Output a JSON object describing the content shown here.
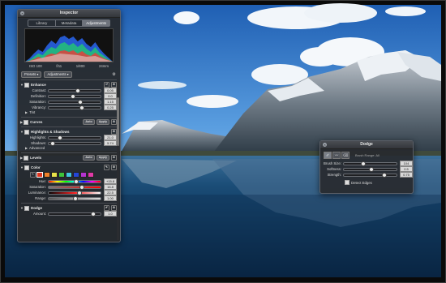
{
  "inspector": {
    "title": "Inspector",
    "tabs": [
      {
        "label": "Library",
        "active": false
      },
      {
        "label": "Metadata",
        "active": false
      },
      {
        "label": "Adjustments",
        "active": true
      }
    ],
    "histogram_info": [
      "ISO 100",
      "f/11",
      "1/800",
      "24mm"
    ],
    "presets_label": "Presets",
    "adjustments_label": "Adjustments",
    "sections": {
      "enhance": {
        "label": "Enhance",
        "sliders": [
          {
            "label": "Contrast:",
            "value": "0.05",
            "level": 0.55
          },
          {
            "label": "Definition:",
            "value": "0.0",
            "level": 0.45
          },
          {
            "label": "Saturation:",
            "value": "1.15",
            "level": 0.6
          },
          {
            "label": "Vibrancy:",
            "value": "0.25",
            "level": 0.62
          }
        ],
        "tint_label": "Tint"
      },
      "curves": {
        "label": "Curves",
        "auto": "Auto",
        "apply": "Apply"
      },
      "highlights_shadows": {
        "label": "Highlights & Shadows",
        "apply": "Apply",
        "sliders": [
          {
            "label": "Highlights:",
            "value": "21.0",
            "level": 0.21
          },
          {
            "label": "Shadows:",
            "value": "5.74",
            "level": 0.06
          }
        ],
        "advanced_label": "Advanced"
      },
      "levels": {
        "label": "Levels",
        "auto": "Auto",
        "apply": "Apply"
      },
      "color": {
        "label": "Color",
        "swatches": [
          "#e0341e",
          "#f0822a",
          "#e8e24a",
          "#3ec43a",
          "#42c8e0",
          "#2446d8",
          "#b434d0",
          "#e03aa8"
        ],
        "selected_swatch": 0,
        "sliders": [
          {
            "label": "Hue:",
            "value": "+15.8",
            "level": 0.52,
            "track": "hue"
          },
          {
            "label": "Saturation:",
            "value": "16.8",
            "level": 0.62,
            "track": "sat"
          },
          {
            "label": "Luminance:",
            "value": "22.5",
            "level": 0.58,
            "track": "lum"
          },
          {
            "label": "Range:",
            "value": "1.00",
            "level": 0.5,
            "track": "rng"
          }
        ]
      },
      "dodge": {
        "label": "Dodge",
        "sliders": [
          {
            "label": "Amount:",
            "value": "1.0",
            "level": 0.85
          }
        ]
      }
    }
  },
  "dodge_hud": {
    "title": "Dodge",
    "tool_desc": "Brush Range: All",
    "sliders": [
      {
        "label": "Brush Size:",
        "value": "104",
        "level": 0.35
      },
      {
        "label": "Softness:",
        "value": "0.5",
        "level": 0.5
      },
      {
        "label": "Strength:",
        "value": "0.75",
        "level": 0.75
      }
    ],
    "detect_edges_label": "Detect Edges"
  },
  "icons": {
    "close": "close-icon",
    "gear": "gear-icon",
    "disclosure": "disclosure-triangle-icon",
    "brush": "brush-icon",
    "feather": "feather-icon",
    "eraser": "eraser-icon"
  }
}
